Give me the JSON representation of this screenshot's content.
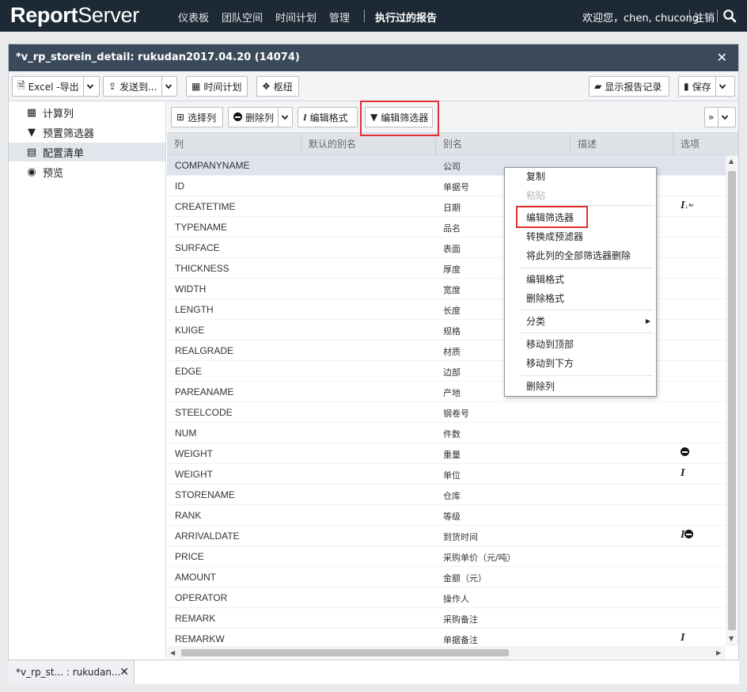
{
  "app": {
    "logo_bold": "Report",
    "logo_light": "Server",
    "nav": [
      "仪表板",
      "团队空间",
      "时间计划",
      "管理"
    ],
    "nav_active": "执行过的报告",
    "welcome": "欢迎您，chen, chucong",
    "logout": "注销"
  },
  "window": {
    "title": "*v_rp_storein_detail: rukudan2017.04.20 (14074)",
    "close": "✕"
  },
  "toolbar": {
    "export": "Excel -导出",
    "send": "发送到...",
    "schedule": "时间计划",
    "pivot": "枢纽",
    "history": "显示报告记录",
    "save": "保存"
  },
  "sidebar": {
    "items": [
      "计算列",
      "预置筛选器",
      "配置清单",
      "预览"
    ]
  },
  "subtoolbar": {
    "select_columns": "选择列",
    "delete_column": "删除列",
    "edit_format": "编辑格式",
    "edit_filter": "编辑筛选器",
    "expand": "»"
  },
  "table": {
    "headers": [
      "列",
      "默认的别名",
      "别名",
      "描述",
      "选项"
    ],
    "rows": [
      {
        "col": "COMPANYNAME",
        "alias": "公司",
        "opt": ""
      },
      {
        "col": "ID",
        "alias": "单据号",
        "opt": ""
      },
      {
        "col": "CREATETIME",
        "alias": "日期",
        "opt": "I"
      },
      {
        "col": "TYPENAME",
        "alias": "品名",
        "opt": ""
      },
      {
        "col": "SURFACE",
        "alias": "表面",
        "opt": ""
      },
      {
        "col": "THICKNESS",
        "alias": "厚度",
        "opt": ""
      },
      {
        "col": "WIDTH",
        "alias": "宽度",
        "opt": ""
      },
      {
        "col": "LENGTH",
        "alias": "长度",
        "opt": ""
      },
      {
        "col": "KUIGE",
        "alias": "规格",
        "opt": ""
      },
      {
        "col": "REALGRADE",
        "alias": "材质",
        "opt": ""
      },
      {
        "col": "EDGE",
        "alias": "边部",
        "opt": ""
      },
      {
        "col": "PAREANAME",
        "alias": "产地",
        "opt": ""
      },
      {
        "col": "STEELCODE",
        "alias": "钢卷号",
        "opt": ""
      },
      {
        "col": "NUM",
        "alias": "件数",
        "opt": ""
      },
      {
        "col": "WEIGHT",
        "alias": "重量",
        "opt": ""
      },
      {
        "col": "WEIGHT",
        "alias": "单位",
        "opt": "I"
      },
      {
        "col": "STORENAME",
        "alias": "仓库",
        "opt": ""
      },
      {
        "col": "RANK",
        "alias": "等级",
        "opt": ""
      },
      {
        "col": "ARRIVALDATE",
        "alias": "到货时间",
        "opt": "I"
      },
      {
        "col": "PRICE",
        "alias": "采购单价（元/吨）",
        "opt": ""
      },
      {
        "col": "AMOUNT",
        "alias": "金额（元）",
        "opt": ""
      },
      {
        "col": "OPERATOR",
        "alias": "操作人",
        "opt": ""
      },
      {
        "col": "REMARK",
        "alias": "采购备注",
        "opt": ""
      },
      {
        "col": "REMARKW",
        "alias": "单据备注",
        "opt": "I"
      }
    ]
  },
  "context_menu": {
    "items": [
      "复制",
      "粘贴",
      "编辑筛选器",
      "转换成预滤器",
      "将此列的全部筛选器删除",
      "编辑格式",
      "删除格式",
      "分类",
      "移动到顶部",
      "移动到下方",
      "删除列"
    ],
    "disabled": "粘贴"
  },
  "tabbar": {
    "tab_label": "*v_rp_st... : rukudan...",
    "tab_close": "✕"
  }
}
